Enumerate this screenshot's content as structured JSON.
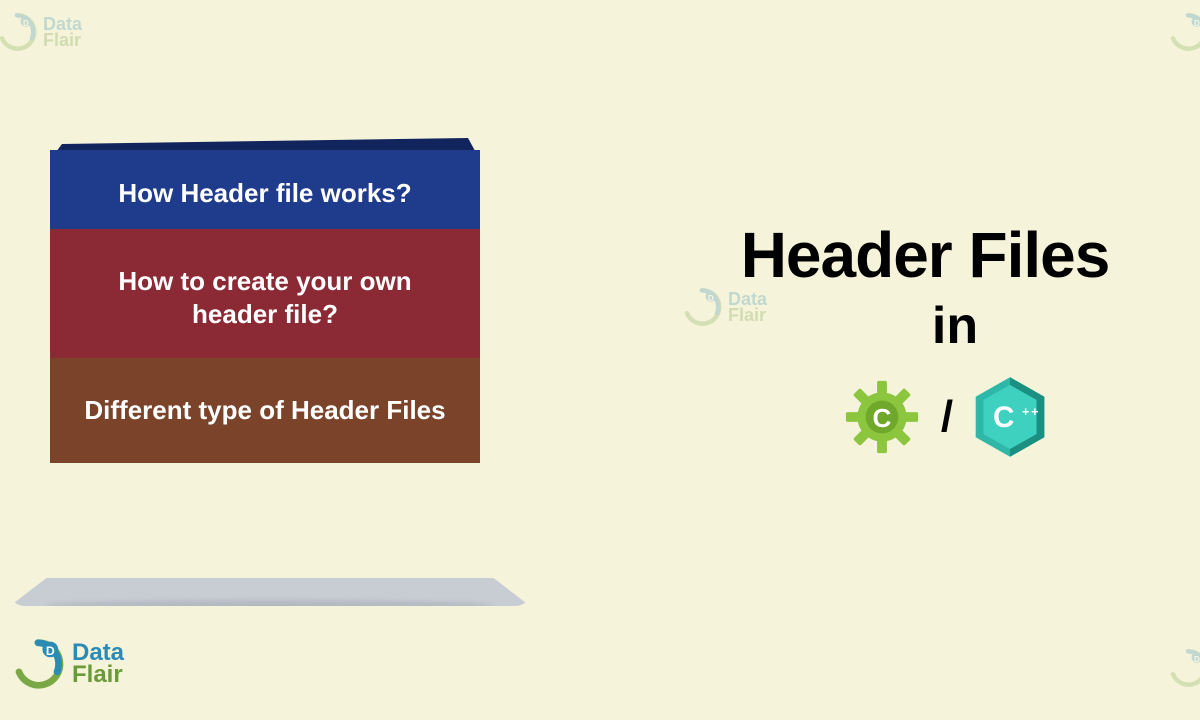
{
  "brand": {
    "line1": "Data",
    "line2": "Flair"
  },
  "ribbons": [
    {
      "text": "How Header file works?",
      "color": "blue"
    },
    {
      "text": "How to create your own header file?",
      "color": "red"
    },
    {
      "text": "Different type of Header Files",
      "color": "brown"
    }
  ],
  "title": {
    "main": "Header Files",
    "preposition": "in"
  },
  "languages": {
    "c_label": "C",
    "cpp_label": "C++",
    "separator": "/"
  }
}
